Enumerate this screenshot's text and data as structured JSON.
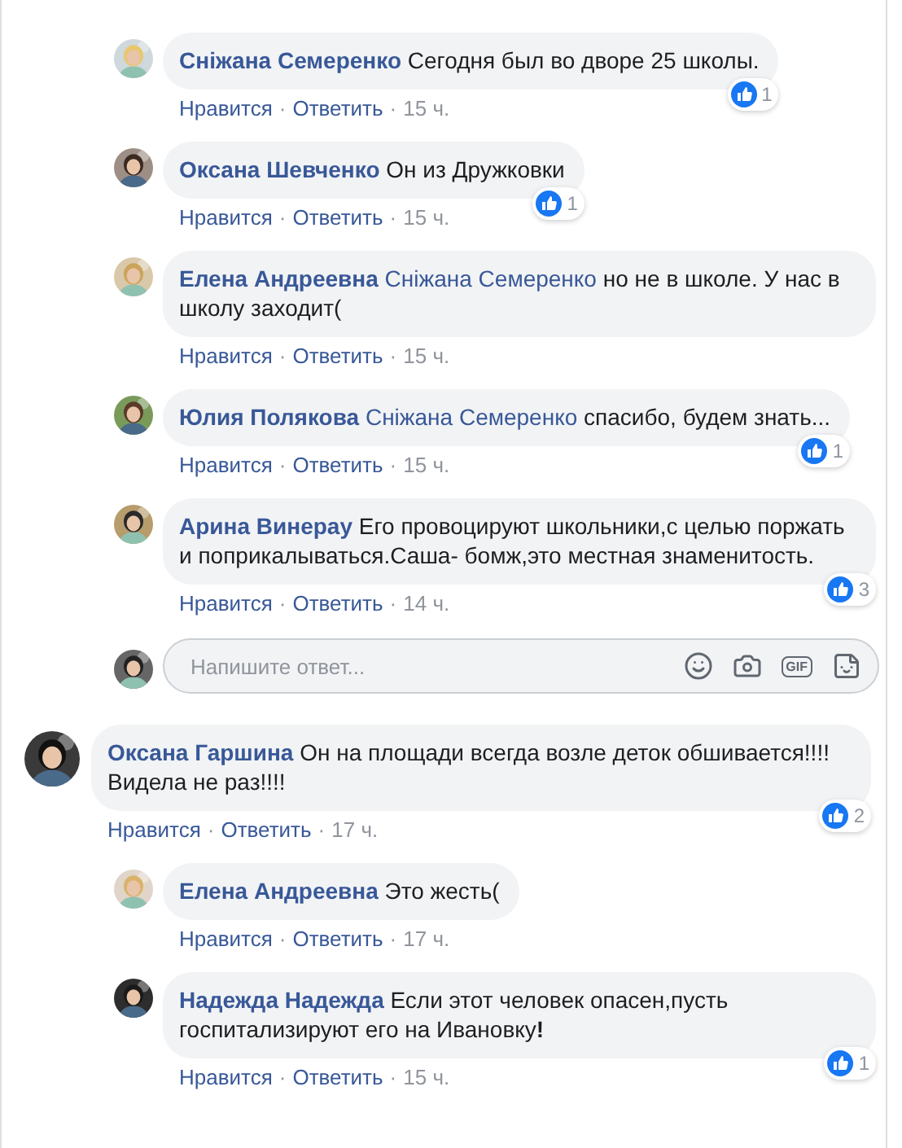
{
  "replies": [
    {
      "author": "Сніжана Семеренко",
      "text": "Сегодня был во дворе 25 школы.",
      "likes": "1",
      "actions": [
        {
          "kind": "link",
          "text": "Нравится"
        },
        {
          "kind": "separator",
          "text": "·"
        },
        {
          "kind": "link",
          "text": "Ответить"
        },
        {
          "kind": "separator",
          "text": "·"
        },
        {
          "kind": "time",
          "text": "15 ч."
        }
      ]
    },
    {
      "author": "Оксана Шевченко",
      "text": "Он из Дружковки",
      "likes": "1",
      "actions": [
        {
          "kind": "link",
          "text": "Нравится"
        },
        {
          "kind": "separator",
          "text": "·"
        },
        {
          "kind": "link",
          "text": "Ответить"
        },
        {
          "kind": "separator",
          "text": "·"
        },
        {
          "kind": "time",
          "text": "15 ч."
        }
      ]
    },
    {
      "author": "Елена Андреевна",
      "mention": "Сніжана Семеренко",
      "text": "но не в школе. У нас в школу заходит(",
      "actions": [
        {
          "kind": "link",
          "text": "Нравится"
        },
        {
          "kind": "separator",
          "text": "·"
        },
        {
          "kind": "link",
          "text": "Ответить"
        },
        {
          "kind": "separator",
          "text": "·"
        },
        {
          "kind": "time",
          "text": "15 ч."
        }
      ]
    },
    {
      "author": "Юлия Полякова",
      "mention": "Сніжана Семеренко",
      "text": "спасибо, будем знать...",
      "likes": "1",
      "actions": [
        {
          "kind": "link",
          "text": "Нравится"
        },
        {
          "kind": "separator",
          "text": "·"
        },
        {
          "kind": "link",
          "text": "Ответить"
        },
        {
          "kind": "separator",
          "text": "·"
        },
        {
          "kind": "time",
          "text": "15 ч."
        }
      ]
    },
    {
      "author": "Арина Винерау",
      "text": "Его провоцируют школьники,с целью поржать и поприкалываться.Саша- бомж,это местная знаменитость.",
      "likes": "3",
      "actions": [
        {
          "kind": "link",
          "text": "Нравится"
        },
        {
          "kind": "separator",
          "text": "·"
        },
        {
          "kind": "link",
          "text": "Ответить"
        },
        {
          "kind": "separator",
          "text": "·"
        },
        {
          "kind": "time",
          "text": "14 ч."
        }
      ]
    }
  ],
  "reply_box": {
    "placeholder": "Напишите ответ...",
    "gif_label": "GIF"
  },
  "comments": [
    {
      "author": "Оксана Гаршина",
      "text": "Он на площади всегда возле деток обшивается!!!! Видела не раз!!!!",
      "likes": "2",
      "actions": [
        {
          "kind": "link",
          "text": "Нравится"
        },
        {
          "kind": "separator",
          "text": "·"
        },
        {
          "kind": "link",
          "text": "Ответить"
        },
        {
          "kind": "separator",
          "text": "·"
        },
        {
          "kind": "time",
          "text": "17 ч."
        }
      ],
      "children": [
        {
          "author": "Елена Андреевна",
          "text": "Это жесть(",
          "actions": [
            {
              "kind": "link",
              "text": "Нравится"
            },
            {
              "kind": "separator",
              "text": "·"
            },
            {
              "kind": "link",
              "text": "Ответить"
            },
            {
              "kind": "separator",
              "text": "·"
            },
            {
              "kind": "time",
              "text": "17 ч."
            }
          ]
        },
        {
          "author": "Надежда Надежда",
          "text": "Если этот человек опасен,пусть госпитализируют его на Ивановку**!**",
          "likes": "1",
          "actions": [
            {
              "kind": "link",
              "text": "Нравится"
            },
            {
              "kind": "separator",
              "text": "·"
            },
            {
              "kind": "link",
              "text": "Ответить"
            },
            {
              "kind": "separator",
              "text": "·"
            },
            {
              "kind": "time",
              "text": "15 ч."
            }
          ]
        }
      ]
    }
  ]
}
